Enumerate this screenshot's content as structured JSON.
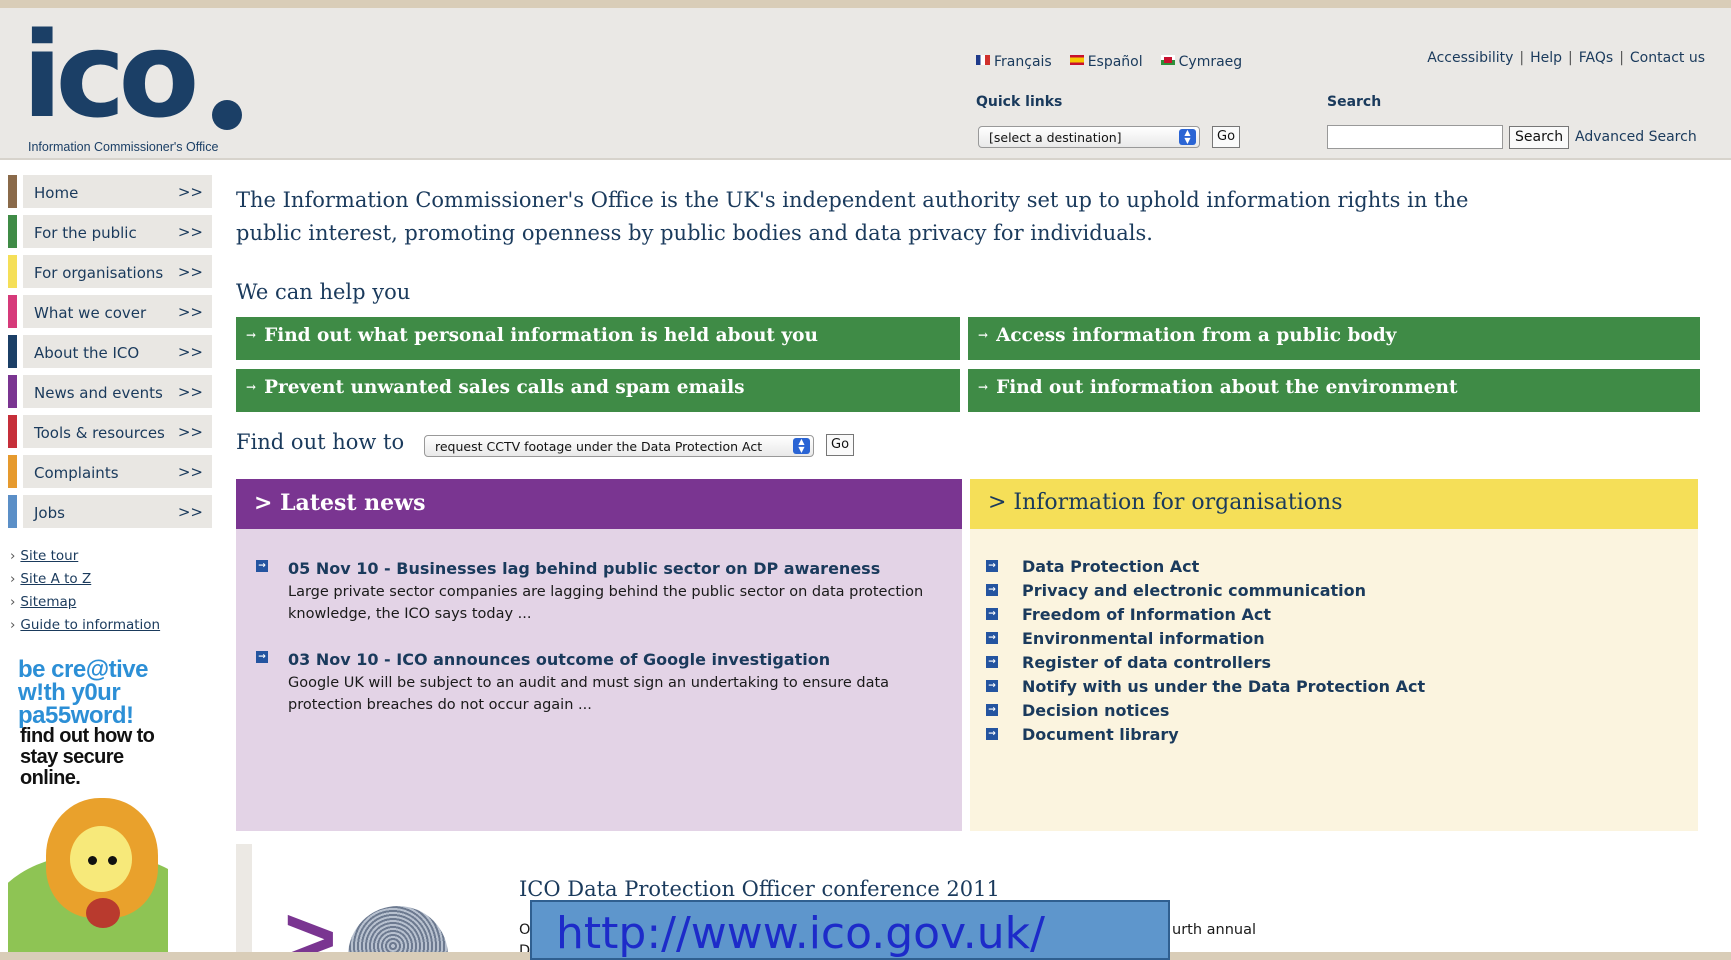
{
  "header": {
    "logo_text": "ico",
    "logo_subtitle": "Information Commissioner's Office",
    "languages": [
      {
        "label": "Français",
        "flag": "france-flag-icon"
      },
      {
        "label": "Español",
        "flag": "spain-flag-icon"
      },
      {
        "label": "Cymraeg",
        "flag": "wales-flag-icon"
      }
    ],
    "top_links": [
      "Accessibility",
      "Help",
      "FAQs",
      "Contact us"
    ],
    "quick_links_label": "Quick links",
    "quick_links_value": "[select a destination]",
    "go_label": "Go",
    "search_label": "Search",
    "search_value": "",
    "search_button": "Search",
    "advanced_search": "Advanced Search"
  },
  "nav": {
    "items": [
      {
        "label": "Home",
        "color": "#8a6a4a"
      },
      {
        "label": "For the public",
        "color": "#3f8b46"
      },
      {
        "label": "For organisations",
        "color": "#f5df58"
      },
      {
        "label": "What we cover",
        "color": "#d63a7a"
      },
      {
        "label": "About the ICO",
        "color": "#1b3f66"
      },
      {
        "label": "News and events",
        "color": "#7a3591"
      },
      {
        "label": "Tools & resources",
        "color": "#c62f3a"
      },
      {
        "label": "Complaints",
        "color": "#e69a2e"
      },
      {
        "label": "Jobs",
        "color": "#5b8fc7"
      }
    ],
    "chevron": ">>",
    "utility_links": [
      "Site tour",
      "Site A to Z",
      "Sitemap",
      "Guide to information"
    ]
  },
  "promo": {
    "line1": "be cre@tive w!th y0ur pa55word!",
    "line2": "find out how to stay secure online."
  },
  "main": {
    "intro": "The Information Commissioner's Office is the UK's independent authority set up to uphold information rights in the public interest, promoting openness by public bodies and data privacy for individuals.",
    "help_heading": "We can help you",
    "help_buttons": [
      "Find out what personal information is held about you",
      "Access information from a public body",
      "Prevent unwanted sales calls and spam emails",
      "Find out information about the environment"
    ],
    "find_out_label": "Find out how to",
    "find_out_value": "request CCTV footage under the Data Protection Act",
    "go_label": "Go"
  },
  "news": {
    "heading": "> Latest news",
    "items": [
      {
        "title": "05 Nov 10 - Businesses lag behind public sector on DP awareness",
        "body": "Large private sector companies are lagging behind the public sector on data protection knowledge, the ICO says today ..."
      },
      {
        "title": "03 Nov 10 - ICO announces outcome of Google investigation",
        "body": "Google UK will be subject to an audit and must sign an undertaking to ensure data protection breaches do not occur again ..."
      }
    ]
  },
  "organisations": {
    "heading": "> Information for organisations",
    "items": [
      "Data Protection Act",
      "Privacy and electronic communication",
      "Freedom of Information Act",
      "Environmental information",
      "Register of data controllers",
      "Notify with us under the Data Protection Act",
      "Decision notices",
      "Document library"
    ]
  },
  "conference": {
    "title": "ICO Data Protection Officer conference 2011",
    "line1_start": "O",
    "line2_start": "D",
    "line1_end": "urth annual"
  },
  "overlay": {
    "url": "http://www.ico.gov.uk/"
  },
  "colors": {
    "brand_navy": "#1b3f66",
    "help_green": "#3f8b46",
    "news_purple": "#7a3591",
    "org_yellow": "#f5df58"
  }
}
